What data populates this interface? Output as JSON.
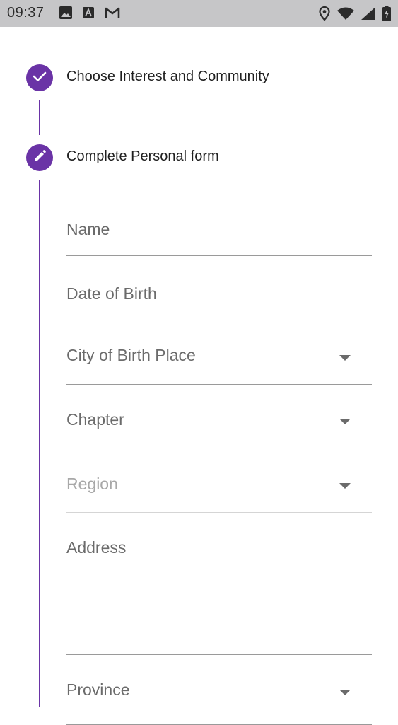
{
  "status_bar": {
    "time": "09:37",
    "left_icons": [
      "image-icon",
      "font-a-icon",
      "gmail-icon"
    ],
    "right_icons": [
      "location-icon",
      "wifi-icon",
      "signal-icon",
      "battery-charging-icon"
    ]
  },
  "stepper": {
    "steps": [
      {
        "title": "Choose Interest and Community",
        "state": "completed",
        "icon": "check-icon"
      },
      {
        "title": "Complete Personal form",
        "state": "editing",
        "icon": "pencil-icon"
      }
    ],
    "accent_color": "#6a33a6"
  },
  "form": {
    "fields": [
      {
        "label": "Name",
        "type": "text"
      },
      {
        "label": "Date of Birth",
        "type": "text"
      },
      {
        "label": "City of Birth Place",
        "type": "dropdown"
      },
      {
        "label": "Chapter",
        "type": "dropdown"
      },
      {
        "label": "Region",
        "type": "dropdown",
        "disabled": true
      },
      {
        "label": "Address",
        "type": "multiline"
      },
      {
        "label": "Province",
        "type": "dropdown"
      }
    ]
  }
}
